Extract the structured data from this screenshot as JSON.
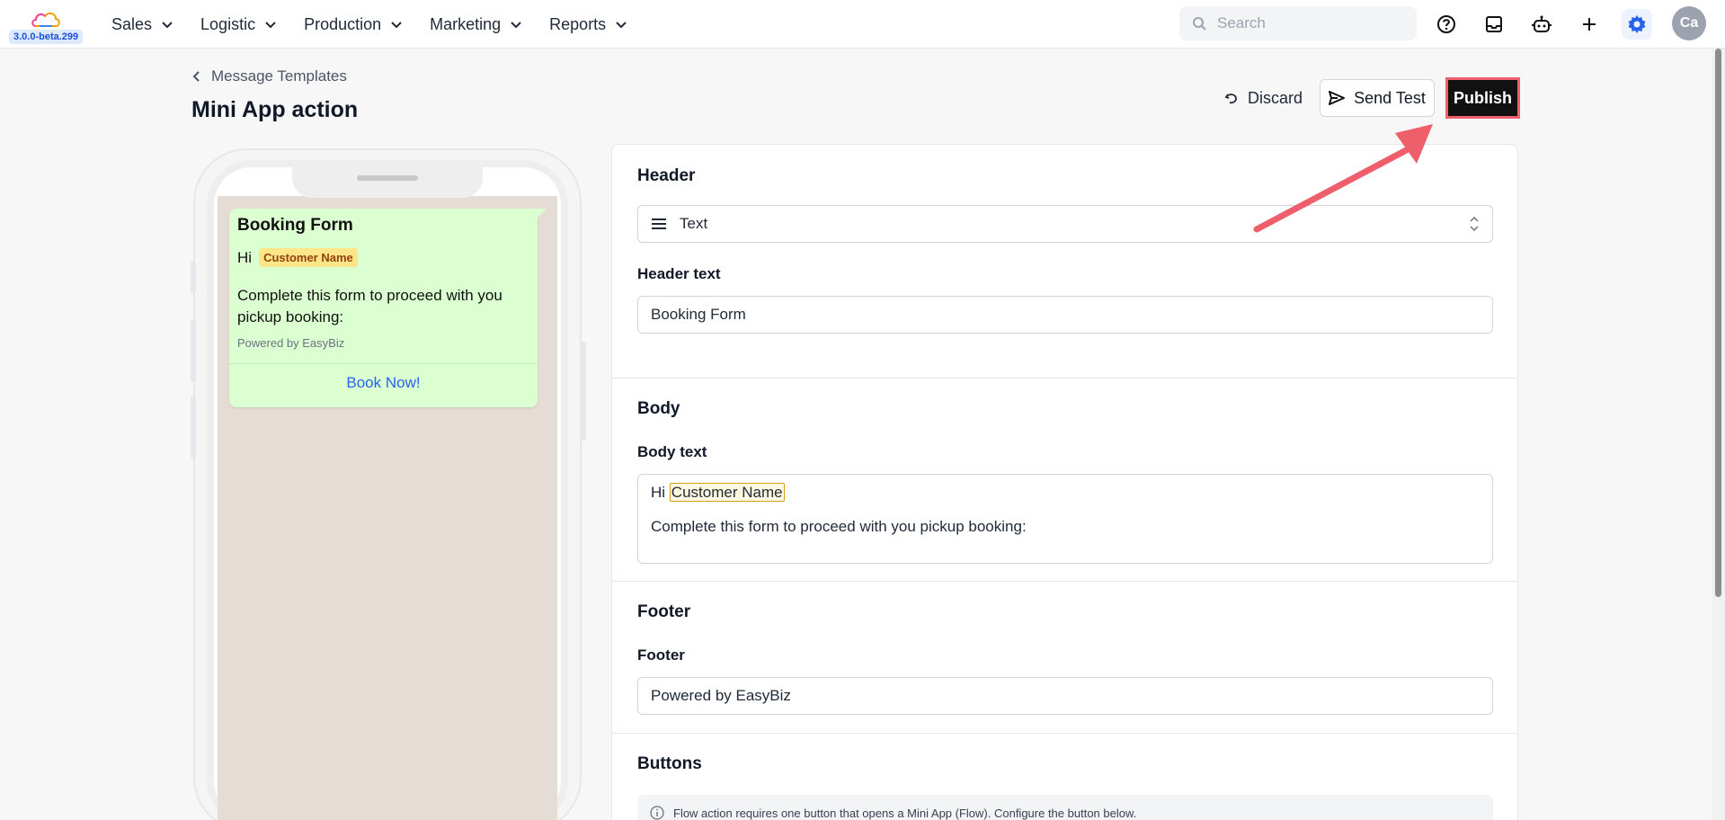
{
  "app": {
    "version": "3.0.0-beta.299"
  },
  "nav": [
    {
      "label": "Sales"
    },
    {
      "label": "Logistic"
    },
    {
      "label": "Production"
    },
    {
      "label": "Marketing"
    },
    {
      "label": "Reports"
    }
  ],
  "search": {
    "placeholder": "Search"
  },
  "topbar_icons": [
    "help-icon",
    "inbox-icon",
    "bot-icon",
    "plus-icon",
    "settings-icon"
  ],
  "user": {
    "initials": "Ca"
  },
  "page": {
    "breadcrumb": "Message Templates",
    "title": "Mini App action",
    "discard_label": "Discard",
    "send_test_label": "Send Test",
    "publish_label": "Publish"
  },
  "preview": {
    "header": "Booking Form",
    "greeting": "Hi",
    "variable": "Customer Name",
    "body": "Complete this form to proceed with you pickup booking:",
    "footer": "Powered by EasyBiz",
    "button": "Book Now!"
  },
  "form": {
    "header": {
      "title": "Header",
      "type_value": "Text",
      "text_label": "Header text",
      "text_value": "Booking Form"
    },
    "body": {
      "title": "Body",
      "text_label": "Body text",
      "greeting": "Hi",
      "variable": "Customer Name",
      "line2": "Complete this form to proceed with you pickup booking:"
    },
    "footer": {
      "title": "Footer",
      "label": "Footer",
      "value": "Powered by EasyBiz"
    },
    "buttons": {
      "title": "Buttons",
      "info": "Flow action requires one button that opens a Mini App (Flow). Configure the button below."
    }
  },
  "colors": {
    "accent": "#2563eb",
    "publish_bg": "#111111",
    "highlight": "#ef5f6b",
    "bubble": "#dcffd2",
    "chat_bg": "#e5ddd5"
  }
}
